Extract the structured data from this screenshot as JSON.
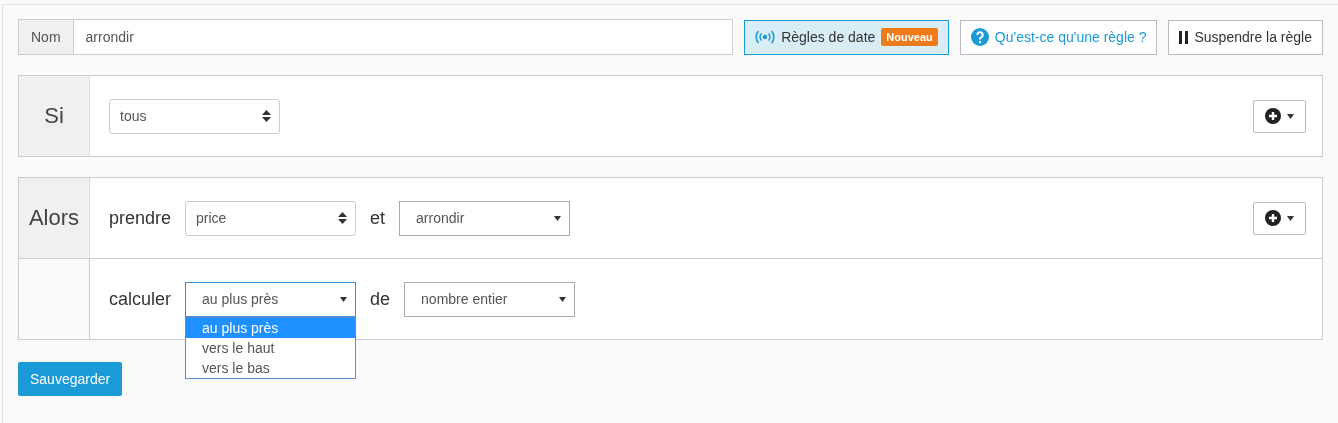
{
  "name_field": {
    "label": "Nom",
    "value": "arrondir"
  },
  "buttons": [
    {
      "kind": "date_rules",
      "label": "Règles de date",
      "badge": "Nouveau"
    },
    {
      "kind": "help",
      "label": "Qu'est-ce qu'une règle ?"
    },
    {
      "kind": "pause",
      "label": "Suspendre la règle"
    }
  ],
  "condition": {
    "label": "Si",
    "rows": [
      {
        "items": [
          {
            "kind": "spinner_select",
            "value": "tous"
          }
        ]
      }
    ]
  },
  "action": {
    "label": "Alors",
    "rows": [
      {
        "items": [
          {
            "kind": "text",
            "text": "prendre"
          },
          {
            "kind": "spinner_select",
            "value": "price"
          },
          {
            "kind": "text",
            "text": "et"
          },
          {
            "kind": "select",
            "value": "arrondir"
          }
        ]
      },
      {
        "items": [
          {
            "kind": "text",
            "text": "calculer"
          },
          {
            "kind": "select",
            "value": "au plus près",
            "open": true,
            "options": [
              {
                "label": "au plus près",
                "selected": true
              },
              {
                "label": "vers le haut",
                "selected": false
              },
              {
                "label": "vers le bas",
                "selected": false
              }
            ]
          },
          {
            "kind": "text",
            "text": "de"
          },
          {
            "kind": "select",
            "value": "nombre entier"
          }
        ]
      }
    ]
  },
  "save_button": "Sauvegarder"
}
